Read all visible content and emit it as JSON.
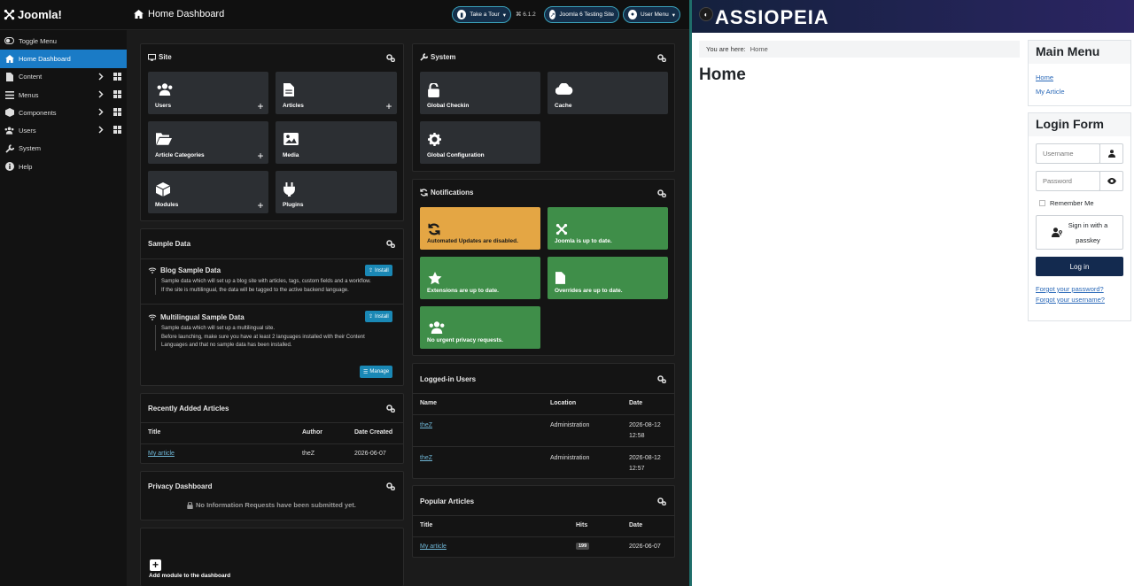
{
  "header": {
    "logo_text": "Joomla!",
    "page_title": "Home Dashboard",
    "take_tour": "Take a Tour",
    "version": "⌘ 6.1.2",
    "site_link": "Joomla 6 Testing Site",
    "user_menu": "User Menu"
  },
  "sidebar": {
    "items": [
      {
        "label": "Toggle Menu",
        "icon": "toggle-icon"
      },
      {
        "label": "Home Dashboard",
        "icon": "home-icon"
      },
      {
        "label": "Content",
        "icon": "file-icon"
      },
      {
        "label": "Menus",
        "icon": "list-icon"
      },
      {
        "label": "Components",
        "icon": "cube-icon"
      },
      {
        "label": "Users",
        "icon": "users-icon"
      },
      {
        "label": "System",
        "icon": "wrench-icon"
      },
      {
        "label": "Help",
        "icon": "info-icon"
      }
    ]
  },
  "site_card": {
    "title": "Site",
    "tiles": [
      "Users",
      "Articles",
      "Article Categories",
      "Media",
      "Modules",
      "Plugins"
    ]
  },
  "system_card": {
    "title": "System",
    "tiles": [
      "Global Checkin",
      "Cache",
      "Global Configuration"
    ]
  },
  "sample_data": {
    "title": "Sample Data",
    "blog_title": "Blog Sample Data",
    "blog_desc1": "Sample data which will set up a blog site with articles, tags, custom fields and a workflow.",
    "blog_desc2": "If the site is multilingual, the data will be tagged to the active backend language.",
    "multi_title": "Multilingual Sample Data",
    "multi_desc1": "Sample data which will set up a multilingual site.",
    "multi_desc2": "Before launching, make sure you have at least 2 languages installed with their Content",
    "multi_desc3": "Languages and that no sample data has been installed.",
    "install": "Install",
    "manage": "Manage"
  },
  "notifications": {
    "title": "Notifications",
    "tiles": [
      {
        "label": "Automated Updates are disabled.",
        "status": "warn"
      },
      {
        "label": "Joomla is up to date.",
        "status": "ok"
      },
      {
        "label": "Extensions are up to date.",
        "status": "ok"
      },
      {
        "label": "Overrides are up to date.",
        "status": "ok"
      },
      {
        "label": "No urgent privacy requests.",
        "status": "ok"
      }
    ]
  },
  "recent_articles": {
    "title": "Recently Added Articles",
    "headers": [
      "Title",
      "Author",
      "Date Created"
    ],
    "rows": [
      [
        "My article",
        "theZ",
        "2026-06-07"
      ]
    ]
  },
  "logged_users": {
    "title": "Logged-in Users",
    "headers": [
      "Name",
      "Location",
      "Date"
    ],
    "rows": [
      [
        "theZ",
        "Administration",
        "2026-08-12",
        "12:58"
      ],
      [
        "theZ",
        "Administration",
        "2026-08-12",
        "12:57"
      ]
    ]
  },
  "privacy": {
    "title": "Privacy Dashboard",
    "message": "No Information Requests have been submitted yet."
  },
  "popular": {
    "title": "Popular Articles",
    "headers": [
      "Title",
      "Hits",
      "Date"
    ],
    "rows": [
      [
        "My article",
        "199",
        "2026-06-07"
      ]
    ]
  },
  "add_module": "Add module to the dashboard",
  "site": {
    "brand": "ASSIOPEIA",
    "breadcrumb_label": "You are here:",
    "breadcrumb_home": "Home",
    "heading": "Home",
    "main_menu_title": "Main Menu",
    "menu_links": [
      "Home",
      "My Article"
    ],
    "login_title": "Login Form",
    "username_ph": "Username",
    "password_ph": "Password",
    "remember": "Remember Me",
    "passkey1": "Sign in with a",
    "passkey2": "passkey",
    "login_btn": "Log in",
    "forgot_password": "Forgot your password?",
    "forgot_username": "Forgot your username?"
  },
  "colors": {
    "accent": "#1a7bc6",
    "warn_tile": "#e4a644",
    "ok_tile": "#3f8e49",
    "login_btn": "#132a4f"
  }
}
